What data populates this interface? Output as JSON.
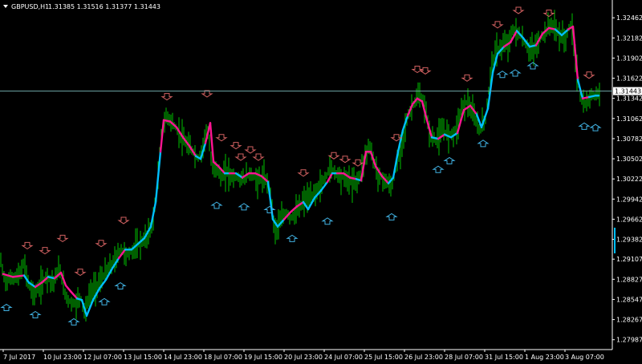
{
  "header": {
    "symbol_timeframe": "GBPUSD,H1",
    "ohlc": "1.31385 1.31516 1.31377 1.31443"
  },
  "price_scale": {
    "labels": [
      "1.32462",
      "1.32182",
      "1.31902",
      "1.31622",
      "1.31342",
      "1.31062",
      "1.30782",
      "1.30502",
      "1.30222",
      "1.29942",
      "1.29662",
      "1.29382",
      "1.29107",
      "1.28827",
      "1.28547",
      "1.28267",
      "1.27987"
    ],
    "current_price_label": "1.31443"
  },
  "time_axis": {
    "labels": [
      "7 Jul 2017",
      "10 Jul 23:00",
      "12 Jul 07:00",
      "13 Jul 15:00",
      "14 Jul 23:00",
      "18 Jul 07:00",
      "19 Jul 15:00",
      "20 Jul 23:00",
      "24 Jul 07:00",
      "25 Jul 15:00",
      "26 Jul 23:00",
      "28 Jul 07:00",
      "31 Jul 15:00",
      "1 Aug 23:00",
      "3 Aug 07:00"
    ]
  },
  "colors": {
    "background": "#000000",
    "bars": "#00c000",
    "line_down": "#ff1493",
    "line_up": "#00bfff",
    "arrow_down": "#d06060",
    "arrow_up": "#40b0e0",
    "grid_line": "#6fa8a8",
    "price_tag_bg": "#ffffff",
    "price_tag_text": "#000000"
  },
  "chart_data": {
    "type": "line",
    "title": "GBPUSD,H1",
    "ylim": [
      1.2785,
      1.3262
    ],
    "price_series": [
      [
        0,
        1.2912
      ],
      [
        6,
        1.288
      ],
      [
        14,
        1.2884
      ],
      [
        24,
        1.2888
      ],
      [
        30,
        1.2905
      ],
      [
        36,
        1.2875
      ],
      [
        42,
        1.2862
      ],
      [
        50,
        1.2872
      ],
      [
        58,
        1.2888
      ],
      [
        66,
        1.2878
      ],
      [
        74,
        1.2898
      ],
      [
        80,
        1.2866
      ],
      [
        86,
        1.2852
      ],
      [
        94,
        1.2848
      ],
      [
        100,
        1.286
      ],
      [
        106,
        1.2836
      ],
      [
        112,
        1.2864
      ],
      [
        120,
        1.2872
      ],
      [
        128,
        1.2886
      ],
      [
        136,
        1.2898
      ],
      [
        144,
        1.291
      ],
      [
        150,
        1.2925
      ],
      [
        158,
        1.2916
      ],
      [
        166,
        1.2924
      ],
      [
        174,
        1.2932
      ],
      [
        182,
        1.294
      ],
      [
        190,
        1.2958
      ],
      [
        196,
        1.301
      ],
      [
        202,
        1.309
      ],
      [
        208,
        1.311
      ],
      [
        216,
        1.3098
      ],
      [
        224,
        1.3084
      ],
      [
        232,
        1.307
      ],
      [
        240,
        1.3062
      ],
      [
        246,
        1.305
      ],
      [
        252,
        1.3062
      ],
      [
        258,
        1.3095
      ],
      [
        264,
        1.304
      ],
      [
        270,
        1.3038
      ],
      [
        276,
        1.3022
      ],
      [
        282,
        1.3034
      ],
      [
        288,
        1.3026
      ],
      [
        296,
        1.3024
      ],
      [
        304,
        1.3022
      ],
      [
        312,
        1.303
      ],
      [
        320,
        1.302
      ],
      [
        328,
        1.3024
      ],
      [
        336,
        1.3012
      ],
      [
        342,
        1.295
      ],
      [
        348,
        1.296
      ],
      [
        356,
        1.2976
      ],
      [
        364,
        1.2968
      ],
      [
        372,
        1.298
      ],
      [
        380,
        1.2994
      ],
      [
        388,
        1.2996
      ],
      [
        396,
        1.3008
      ],
      [
        404,
        1.302
      ],
      [
        410,
        1.3036
      ],
      [
        416,
        1.3034
      ],
      [
        424,
        1.3026
      ],
      [
        432,
        1.3022
      ],
      [
        440,
        1.3016
      ],
      [
        448,
        1.3024
      ],
      [
        454,
        1.305
      ],
      [
        460,
        1.307
      ],
      [
        466,
        1.3046
      ],
      [
        472,
        1.3026
      ],
      [
        480,
        1.302
      ],
      [
        488,
        1.301
      ],
      [
        494,
        1.304
      ],
      [
        500,
        1.307
      ],
      [
        506,
        1.31
      ],
      [
        512,
        1.312
      ],
      [
        518,
        1.3132
      ],
      [
        524,
        1.3138
      ],
      [
        530,
        1.312
      ],
      [
        536,
        1.3082
      ],
      [
        544,
        1.3076
      ],
      [
        552,
        1.309
      ],
      [
        560,
        1.3084
      ],
      [
        568,
        1.309
      ],
      [
        576,
        1.3122
      ],
      [
        582,
        1.313
      ],
      [
        590,
        1.311
      ],
      [
        598,
        1.309
      ],
      [
        606,
        1.311
      ],
      [
        612,
        1.3178
      ],
      [
        618,
        1.32
      ],
      [
        626,
        1.3206
      ],
      [
        634,
        1.3212
      ],
      [
        640,
        1.323
      ],
      [
        648,
        1.3222
      ],
      [
        656,
        1.3206
      ],
      [
        664,
        1.32
      ],
      [
        672,
        1.3214
      ],
      [
        680,
        1.3228
      ],
      [
        688,
        1.3238
      ],
      [
        696,
        1.3224
      ],
      [
        704,
        1.3216
      ],
      [
        712,
        1.324
      ],
      [
        718,
        1.318
      ],
      [
        724,
        1.313
      ],
      [
        730,
        1.3124
      ],
      [
        738,
        1.314
      ],
      [
        746,
        1.314
      ]
    ],
    "signal_line": [
      [
        4,
        1.289,
        "up"
      ],
      [
        16,
        1.2886,
        "down"
      ],
      [
        30,
        1.2888,
        "down"
      ],
      [
        36,
        1.2878,
        "up"
      ],
      [
        44,
        1.2872,
        "up"
      ],
      [
        52,
        1.2878,
        "down"
      ],
      [
        60,
        1.2886,
        "down"
      ],
      [
        68,
        1.2884,
        "up"
      ],
      [
        76,
        1.2892,
        "down"
      ],
      [
        82,
        1.2874,
        "down"
      ],
      [
        88,
        1.2866,
        "down"
      ],
      [
        96,
        1.2856,
        "down"
      ],
      [
        102,
        1.2854,
        "up"
      ],
      [
        108,
        1.2832,
        "up"
      ],
      [
        116,
        1.2854,
        "up"
      ],
      [
        124,
        1.287,
        "up"
      ],
      [
        132,
        1.2882,
        "up"
      ],
      [
        140,
        1.2898,
        "up"
      ],
      [
        148,
        1.2912,
        "up"
      ],
      [
        156,
        1.2924,
        "down"
      ],
      [
        164,
        1.2924,
        "up"
      ],
      [
        172,
        1.2932,
        "up"
      ],
      [
        180,
        1.294,
        "up"
      ],
      [
        188,
        1.2956,
        "up"
      ],
      [
        194,
        1.299,
        "up"
      ],
      [
        200,
        1.306,
        "up"
      ],
      [
        204,
        1.3104,
        "down"
      ],
      [
        212,
        1.3102,
        "down"
      ],
      [
        220,
        1.3094,
        "down"
      ],
      [
        228,
        1.308,
        "down"
      ],
      [
        236,
        1.3068,
        "down"
      ],
      [
        244,
        1.3054,
        "down"
      ],
      [
        250,
        1.305,
        "up"
      ],
      [
        256,
        1.3072,
        "up"
      ],
      [
        262,
        1.31,
        "down"
      ],
      [
        266,
        1.3046,
        "down"
      ],
      [
        272,
        1.304,
        "down"
      ],
      [
        280,
        1.303,
        "down"
      ],
      [
        286,
        1.303,
        "up"
      ],
      [
        294,
        1.303,
        "down"
      ],
      [
        302,
        1.3024,
        "up"
      ],
      [
        310,
        1.303,
        "down"
      ],
      [
        318,
        1.303,
        "down"
      ],
      [
        326,
        1.3026,
        "down"
      ],
      [
        334,
        1.3018,
        "down"
      ],
      [
        340,
        1.2966,
        "up"
      ],
      [
        346,
        1.2956,
        "up"
      ],
      [
        354,
        1.2966,
        "up"
      ],
      [
        362,
        1.2976,
        "down"
      ],
      [
        370,
        1.2984,
        "down"
      ],
      [
        378,
        1.299,
        "down"
      ],
      [
        384,
        1.298,
        "up"
      ],
      [
        392,
        1.2996,
        "up"
      ],
      [
        400,
        1.3006,
        "up"
      ],
      [
        408,
        1.3018,
        "up"
      ],
      [
        414,
        1.303,
        "down"
      ],
      [
        420,
        1.303,
        "up"
      ],
      [
        428,
        1.303,
        "down"
      ],
      [
        436,
        1.3024,
        "down"
      ],
      [
        444,
        1.3022,
        "down"
      ],
      [
        450,
        1.302,
        "up"
      ],
      [
        456,
        1.306,
        "down"
      ],
      [
        462,
        1.306,
        "down"
      ],
      [
        468,
        1.304,
        "down"
      ],
      [
        476,
        1.3026,
        "down"
      ],
      [
        484,
        1.3016,
        "down"
      ],
      [
        490,
        1.3024,
        "up"
      ],
      [
        496,
        1.306,
        "up"
      ],
      [
        502,
        1.309,
        "up"
      ],
      [
        508,
        1.311,
        "up"
      ],
      [
        514,
        1.3126,
        "down"
      ],
      [
        520,
        1.3134,
        "down"
      ],
      [
        526,
        1.313,
        "down"
      ],
      [
        532,
        1.3104,
        "down"
      ],
      [
        538,
        1.308,
        "down"
      ],
      [
        546,
        1.3078,
        "up"
      ],
      [
        554,
        1.3084,
        "down"
      ],
      [
        562,
        1.308,
        "up"
      ],
      [
        570,
        1.3086,
        "up"
      ],
      [
        578,
        1.3118,
        "down"
      ],
      [
        586,
        1.3124,
        "down"
      ],
      [
        594,
        1.3112,
        "down"
      ],
      [
        600,
        1.3094,
        "up"
      ],
      [
        608,
        1.312,
        "up"
      ],
      [
        614,
        1.317,
        "up"
      ],
      [
        620,
        1.3196,
        "up"
      ],
      [
        628,
        1.3206,
        "up"
      ],
      [
        636,
        1.3212,
        "down"
      ],
      [
        644,
        1.3228,
        "down"
      ],
      [
        652,
        1.3218,
        "up"
      ],
      [
        660,
        1.3206,
        "up"
      ],
      [
        668,
        1.3208,
        "up"
      ],
      [
        676,
        1.3224,
        "down"
      ],
      [
        684,
        1.3232,
        "down"
      ],
      [
        692,
        1.323,
        "down"
      ],
      [
        700,
        1.3222,
        "up"
      ],
      [
        708,
        1.323,
        "up"
      ],
      [
        714,
        1.3234,
        "down"
      ],
      [
        720,
        1.316,
        "down"
      ],
      [
        726,
        1.3134,
        "up"
      ],
      [
        734,
        1.3136,
        "down"
      ],
      [
        742,
        1.3138,
        "up"
      ],
      [
        746,
        1.3138,
        "up"
      ]
    ],
    "arrows_down": [
      [
        34,
        1.2925
      ],
      [
        56,
        1.2918
      ],
      [
        78,
        1.2935
      ],
      [
        100,
        1.2888
      ],
      [
        126,
        1.2928
      ],
      [
        154,
        1.296
      ],
      [
        208,
        1.3132
      ],
      [
        258,
        1.3136
      ],
      [
        276,
        1.3075
      ],
      [
        294,
        1.3064
      ],
      [
        300,
        1.3048
      ],
      [
        312,
        1.3058
      ],
      [
        322,
        1.3048
      ],
      [
        378,
        1.3026
      ],
      [
        416,
        1.305
      ],
      [
        430,
        1.3045
      ],
      [
        446,
        1.304
      ],
      [
        494,
        1.3075
      ],
      [
        520,
        1.317
      ],
      [
        530,
        1.3168
      ],
      [
        582,
        1.3158
      ],
      [
        620,
        1.3232
      ],
      [
        646,
        1.3252
      ],
      [
        684,
        1.3248
      ],
      [
        734,
        1.3162
      ]
    ],
    "arrows_up": [
      [
        8,
        1.2848
      ],
      [
        44,
        1.2838
      ],
      [
        92,
        1.2828
      ],
      [
        130,
        1.2856
      ],
      [
        150,
        1.2878
      ],
      [
        270,
        1.299
      ],
      [
        304,
        1.2988
      ],
      [
        336,
        1.2984
      ],
      [
        364,
        1.2944
      ],
      [
        408,
        1.2968
      ],
      [
        488,
        1.2974
      ],
      [
        546,
        1.304
      ],
      [
        560,
        1.3052
      ],
      [
        602,
        1.3076
      ],
      [
        626,
        1.3172
      ],
      [
        642,
        1.3174
      ],
      [
        664,
        1.3184
      ],
      [
        728,
        1.31
      ],
      [
        742,
        1.3098
      ]
    ],
    "current_price": 1.31443
  }
}
